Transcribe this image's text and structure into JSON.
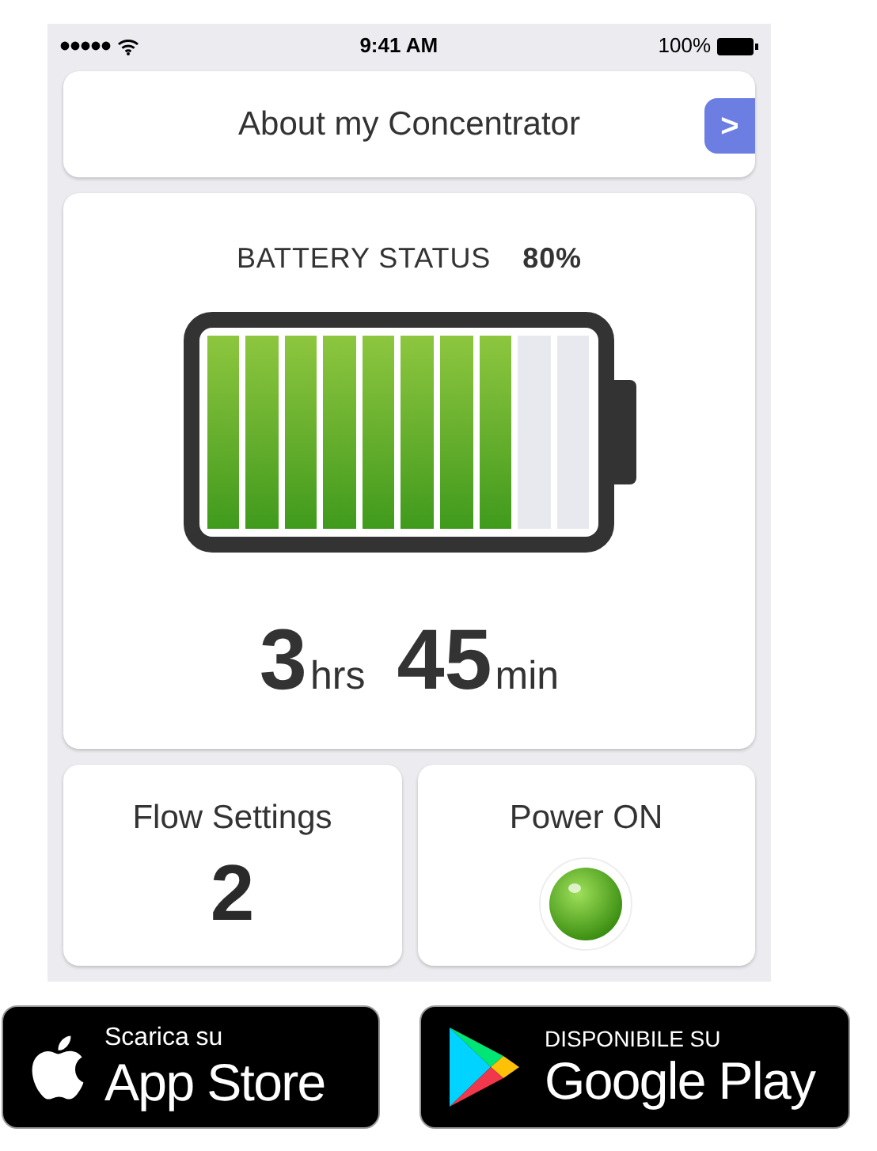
{
  "status_bar": {
    "time": "9:41 AM",
    "battery": "100%"
  },
  "header": {
    "title": "About my Concentrator",
    "chevron": ">"
  },
  "battery": {
    "label": "BATTERY STATUS",
    "percent": "80%",
    "segments": [
      {
        "filled": true
      },
      {
        "filled": true
      },
      {
        "filled": true
      },
      {
        "filled": true
      },
      {
        "filled": true
      },
      {
        "filled": true
      },
      {
        "filled": true
      },
      {
        "filled": true
      },
      {
        "filled": false
      },
      {
        "filled": false
      }
    ],
    "hours": "3",
    "hours_unit": "hrs",
    "minutes": "45",
    "minutes_unit": "min"
  },
  "flow": {
    "title": "Flow Settings",
    "value": "2"
  },
  "power": {
    "title": "Power ON",
    "on": true
  },
  "badges": [
    {
      "kind": "apple",
      "small": "Scarica su",
      "big": "App Store"
    },
    {
      "kind": "google",
      "small": "DISPONIBILE SU",
      "big": "Google Play"
    }
  ]
}
